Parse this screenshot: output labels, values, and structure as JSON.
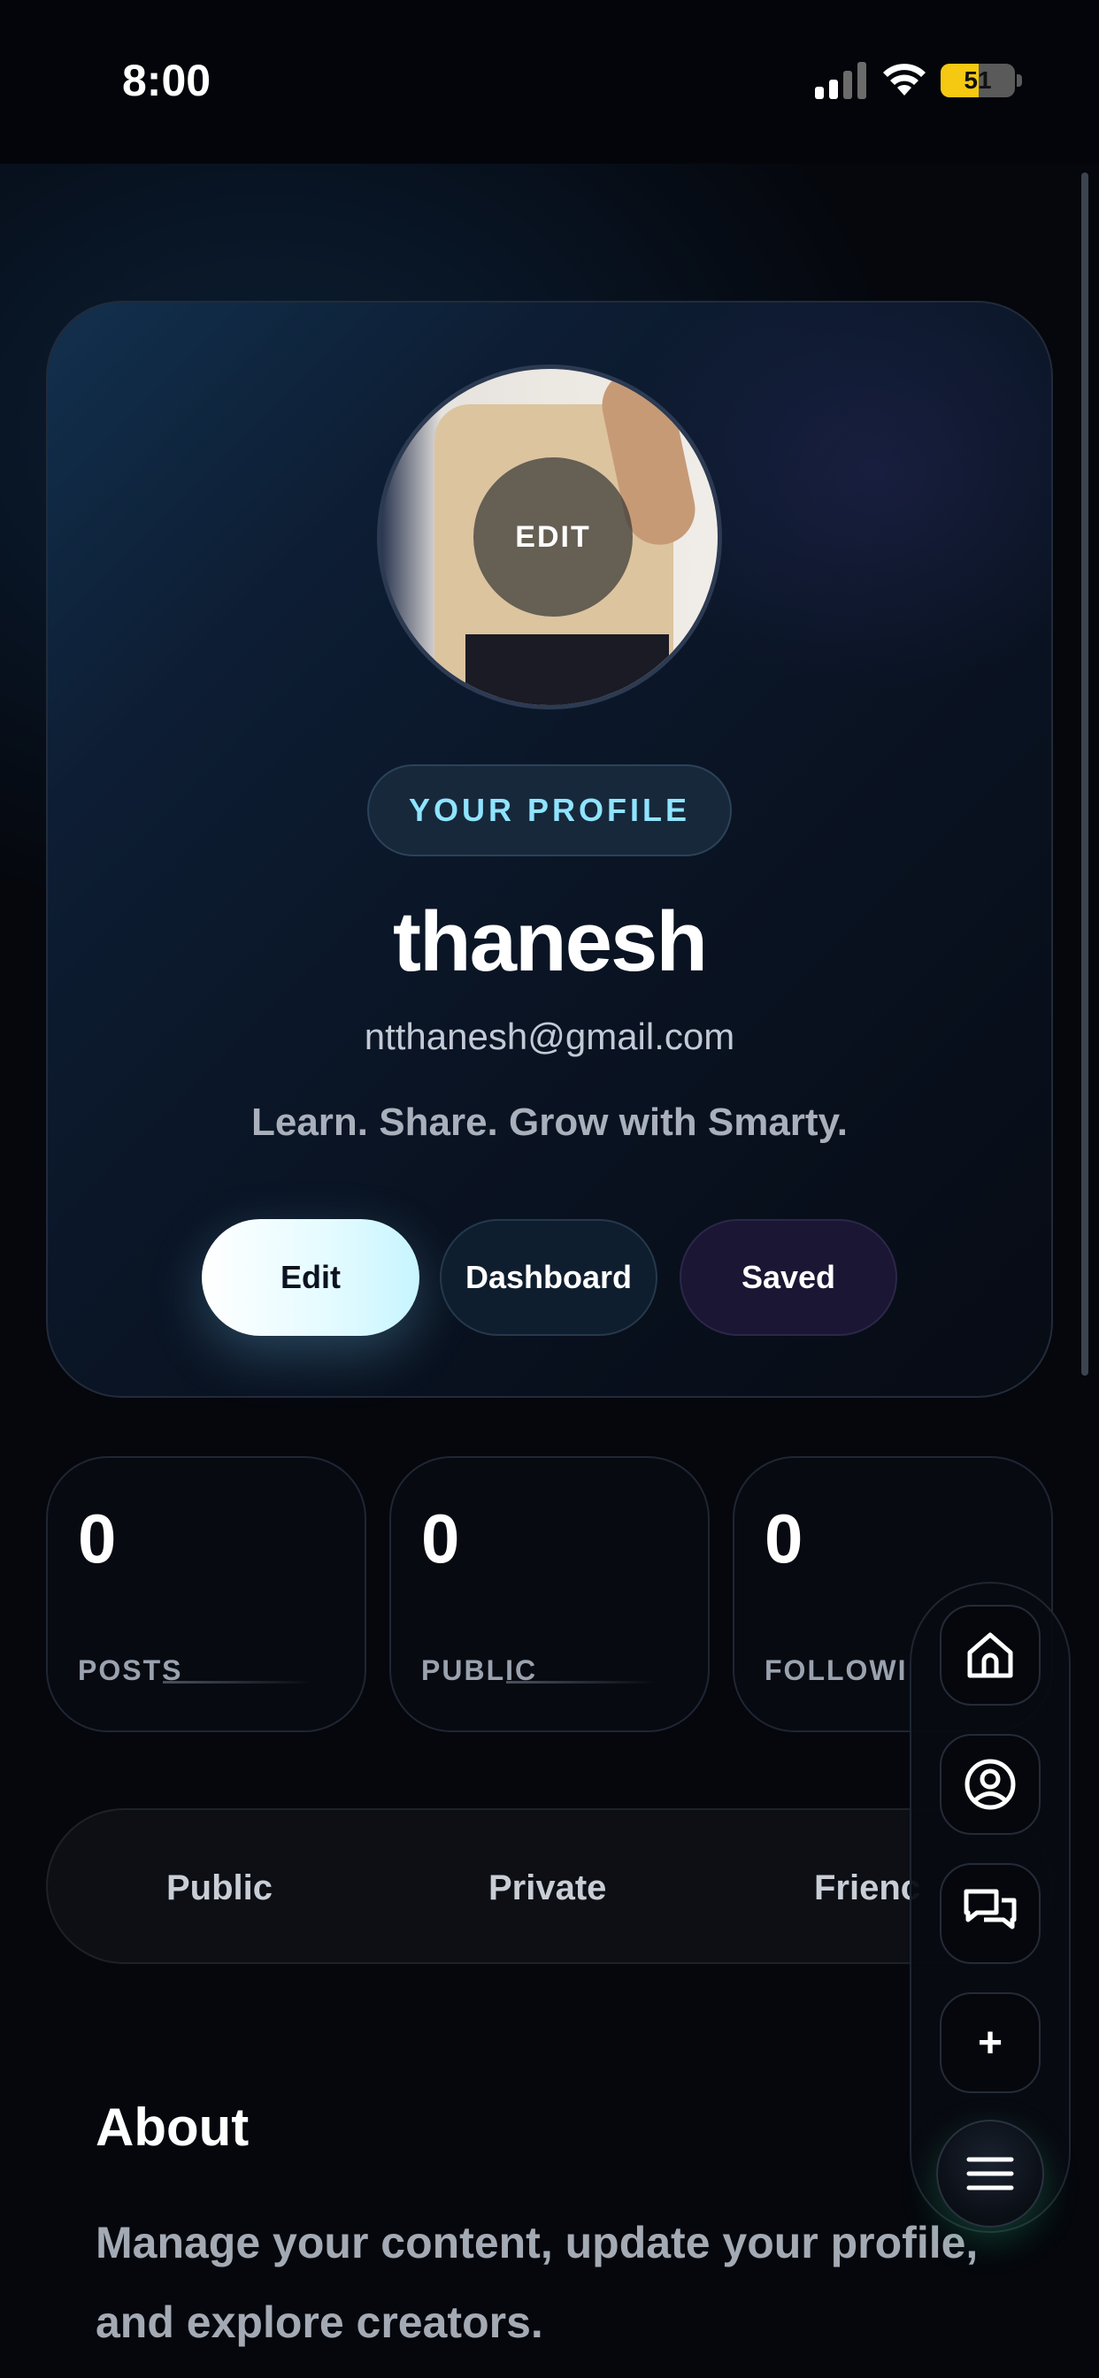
{
  "status_bar": {
    "time": "8:00",
    "battery": "51",
    "battery_level": 0.51
  },
  "profile": {
    "avatar_overlay": "EDIT",
    "badge": "YOUR PROFILE",
    "name": "thanesh",
    "email": "ntthanesh@gmail.com",
    "tagline": "Learn. Share. Grow with Smarty.",
    "buttons": {
      "edit": "Edit",
      "dashboard": "Dashboard",
      "saved": "Saved"
    }
  },
  "stats": [
    {
      "value": "0",
      "label": "POSTS"
    },
    {
      "value": "0",
      "label": "PUBLIC"
    },
    {
      "value": "0",
      "label": "FOLLOWI"
    }
  ],
  "tabs": [
    "Public",
    "Private",
    "Frienc"
  ],
  "about": {
    "title": "About",
    "text": "Manage your content, update your profile, and explore creators."
  },
  "fab_menu": {
    "items": [
      "home-icon",
      "profile-icon",
      "chat-icon",
      "plus-icon"
    ],
    "plus_label": "+",
    "menu_icon": "hamburger-menu-icon"
  }
}
